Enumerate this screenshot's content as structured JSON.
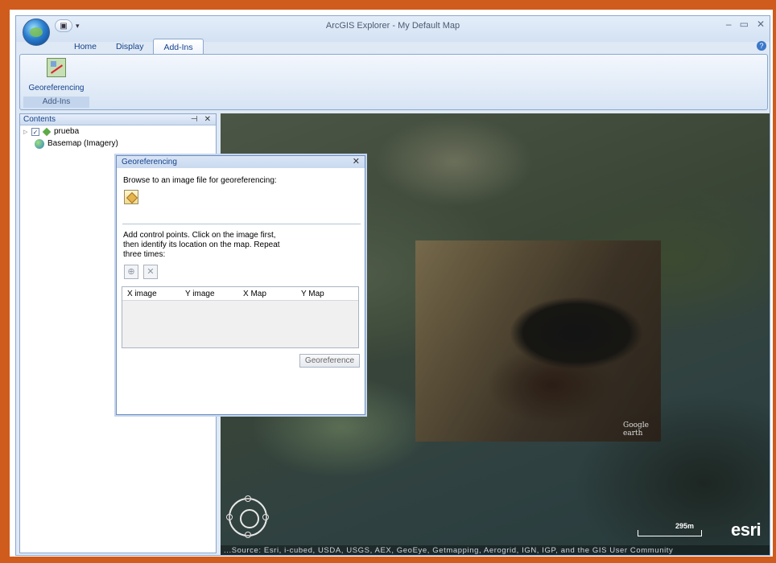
{
  "app": {
    "title": "ArcGIS Explorer - My Default Map",
    "window_controls": [
      "–",
      "▭",
      "✕"
    ]
  },
  "ribbon": {
    "tabs": [
      {
        "label": "Home",
        "active": false
      },
      {
        "label": "Display",
        "active": false
      },
      {
        "label": "Add-Ins",
        "active": true
      }
    ],
    "group": {
      "button_label": "Georeferencing",
      "group_label": "Add-Ins"
    },
    "help_icon": "?"
  },
  "contents": {
    "title": "Contents",
    "pin": "⊣",
    "close": "✕",
    "layers": [
      {
        "name": "prueba",
        "checked": true,
        "icon": "layer-icon"
      },
      {
        "name": "Basemap (Imagery)",
        "icon": "globe-icon"
      }
    ]
  },
  "dialog": {
    "title": "Georeferencing",
    "close": "✕",
    "browse_text": "Browse to an image file for georeferencing:",
    "control_text_1": "Add control points. Click on the image first,",
    "control_text_2": "then identify its location on the map. Repeat",
    "control_text_3": "three times:",
    "add_point_icon": "⊕",
    "delete_point_icon": "✕",
    "columns": [
      "X image",
      "Y image",
      "X Map",
      "Y Map"
    ],
    "button": "Georeference"
  },
  "map": {
    "overlay_ge": "Google earth",
    "scale": "295m",
    "logo": "esri",
    "attribution": "...Source: Esri, i-cubed, USDA, USGS, AEX, GeoEye, Getmapping, Aerogrid, IGN, IGP, and the GIS User Community"
  }
}
